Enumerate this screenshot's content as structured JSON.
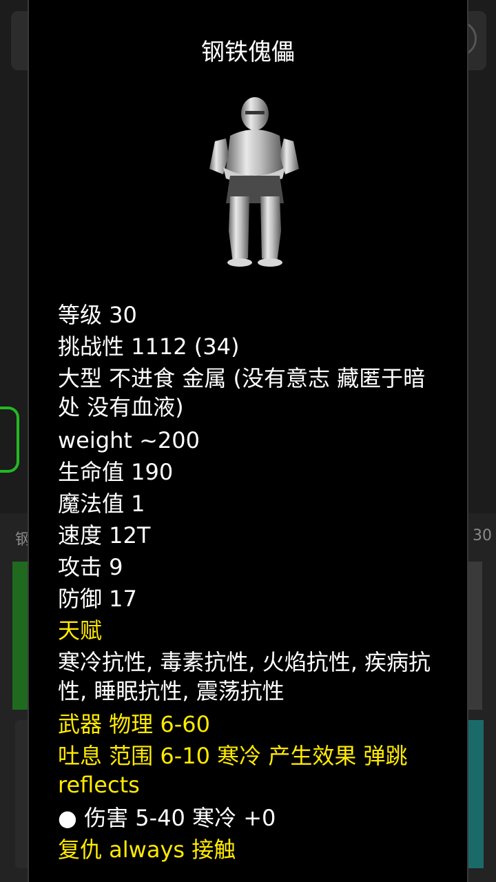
{
  "background": {
    "left_label": "钢",
    "right_label": "30"
  },
  "dialog": {
    "title": "钢铁傀儡",
    "portrait_icon": "steel-golem-knight-icon",
    "stats": [
      {
        "text": "等级 30",
        "color": "white"
      },
      {
        "text": "挑战性 1112 (34)",
        "color": "white"
      },
      {
        "text": "大型 不进食 金属 (没有意志 藏匿于暗处 没有血液)",
        "color": "white"
      },
      {
        "text": "weight ~200",
        "color": "white"
      },
      {
        "text": "生命值 190",
        "color": "white"
      },
      {
        "text": "魔法值 1",
        "color": "white"
      },
      {
        "text": "速度 12T",
        "color": "white"
      },
      {
        "text": "攻击 9",
        "color": "white"
      },
      {
        "text": "防御 17",
        "color": "white"
      },
      {
        "text": "天赋",
        "color": "yellow"
      },
      {
        "text": "寒冷抗性, 毒素抗性, 火焰抗性, 疾病抗性, 睡眠抗性, 震荡抗性",
        "color": "white"
      },
      {
        "text": "武器 物理 6-60",
        "color": "yellow"
      },
      {
        "text": "吐息 范围 6-10 寒冷 产生效果 弹跳 reflects",
        "color": "yellow"
      },
      {
        "text": "● 伤害 5-40 寒冷 +0",
        "color": "white"
      },
      {
        "text": "复仇 always 接触",
        "color": "yellow"
      }
    ]
  },
  "colors": {
    "highlight": "#ffea00",
    "text": "#ffffff",
    "dialog_bg": "#000000"
  }
}
